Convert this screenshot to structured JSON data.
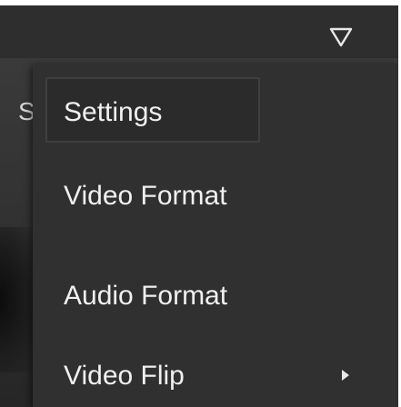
{
  "toolbar": {
    "filter_icon": "filter-icon"
  },
  "background": {
    "partial_text": "S"
  },
  "menu": {
    "items": [
      {
        "label": "Settings",
        "selected": true,
        "has_submenu": false
      },
      {
        "label": "Video Format",
        "selected": false,
        "has_submenu": false
      },
      {
        "label": "Audio Format",
        "selected": false,
        "has_submenu": false
      },
      {
        "label": "Video Flip",
        "selected": false,
        "has_submenu": true
      }
    ]
  },
  "colors": {
    "menu_bg": "#303030",
    "text": "#f0f0f0",
    "highlight_border": "#3f3f3f"
  }
}
